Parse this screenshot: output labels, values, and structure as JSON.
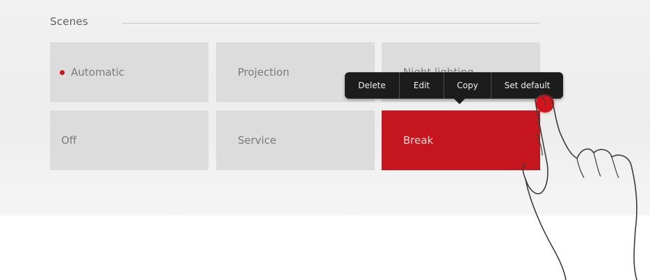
{
  "scenes": {
    "title": "Scenes",
    "accent_color": "#c5161f",
    "tiles": [
      {
        "label": "Automatic",
        "indicator": true
      },
      {
        "label": "Projection"
      },
      {
        "label": "Night lighting"
      },
      {
        "label": "Off"
      },
      {
        "label": "Service"
      },
      {
        "label": "Break",
        "selected": true
      }
    ]
  },
  "context_menu": {
    "items": [
      "Delete",
      "Edit",
      "Copy",
      "Set default"
    ]
  },
  "icons": {
    "hand": "hand-pointer-icon",
    "touch": "touch-point-icon"
  }
}
